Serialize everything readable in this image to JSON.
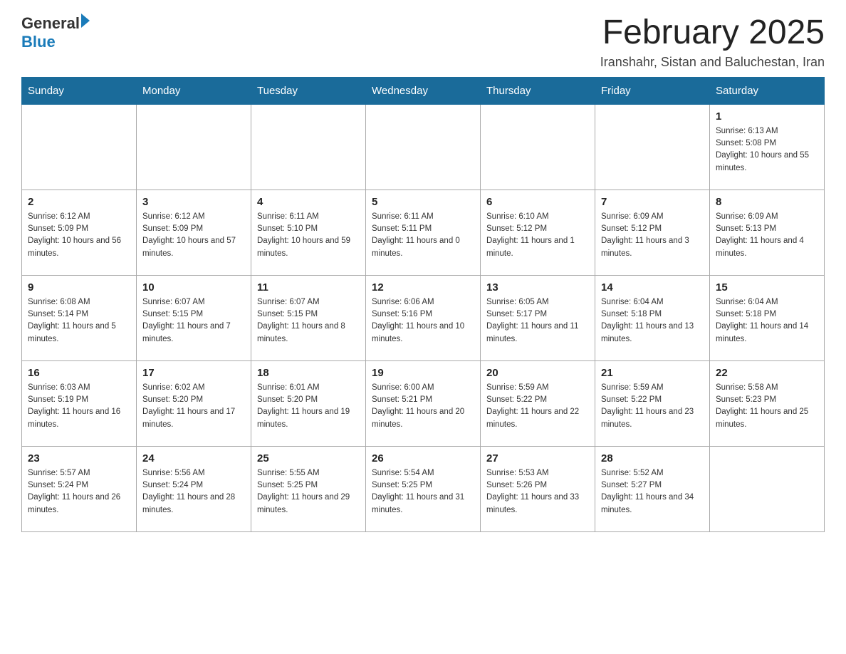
{
  "logo": {
    "general": "General",
    "blue": "Blue"
  },
  "title": "February 2025",
  "location": "Iranshahr, Sistan and Baluchestan, Iran",
  "days_of_week": [
    "Sunday",
    "Monday",
    "Tuesday",
    "Wednesday",
    "Thursday",
    "Friday",
    "Saturday"
  ],
  "weeks": [
    [
      {
        "day": "",
        "info": ""
      },
      {
        "day": "",
        "info": ""
      },
      {
        "day": "",
        "info": ""
      },
      {
        "day": "",
        "info": ""
      },
      {
        "day": "",
        "info": ""
      },
      {
        "day": "",
        "info": ""
      },
      {
        "day": "1",
        "info": "Sunrise: 6:13 AM\nSunset: 5:08 PM\nDaylight: 10 hours and 55 minutes."
      }
    ],
    [
      {
        "day": "2",
        "info": "Sunrise: 6:12 AM\nSunset: 5:09 PM\nDaylight: 10 hours and 56 minutes."
      },
      {
        "day": "3",
        "info": "Sunrise: 6:12 AM\nSunset: 5:09 PM\nDaylight: 10 hours and 57 minutes."
      },
      {
        "day": "4",
        "info": "Sunrise: 6:11 AM\nSunset: 5:10 PM\nDaylight: 10 hours and 59 minutes."
      },
      {
        "day": "5",
        "info": "Sunrise: 6:11 AM\nSunset: 5:11 PM\nDaylight: 11 hours and 0 minutes."
      },
      {
        "day": "6",
        "info": "Sunrise: 6:10 AM\nSunset: 5:12 PM\nDaylight: 11 hours and 1 minute."
      },
      {
        "day": "7",
        "info": "Sunrise: 6:09 AM\nSunset: 5:12 PM\nDaylight: 11 hours and 3 minutes."
      },
      {
        "day": "8",
        "info": "Sunrise: 6:09 AM\nSunset: 5:13 PM\nDaylight: 11 hours and 4 minutes."
      }
    ],
    [
      {
        "day": "9",
        "info": "Sunrise: 6:08 AM\nSunset: 5:14 PM\nDaylight: 11 hours and 5 minutes."
      },
      {
        "day": "10",
        "info": "Sunrise: 6:07 AM\nSunset: 5:15 PM\nDaylight: 11 hours and 7 minutes."
      },
      {
        "day": "11",
        "info": "Sunrise: 6:07 AM\nSunset: 5:15 PM\nDaylight: 11 hours and 8 minutes."
      },
      {
        "day": "12",
        "info": "Sunrise: 6:06 AM\nSunset: 5:16 PM\nDaylight: 11 hours and 10 minutes."
      },
      {
        "day": "13",
        "info": "Sunrise: 6:05 AM\nSunset: 5:17 PM\nDaylight: 11 hours and 11 minutes."
      },
      {
        "day": "14",
        "info": "Sunrise: 6:04 AM\nSunset: 5:18 PM\nDaylight: 11 hours and 13 minutes."
      },
      {
        "day": "15",
        "info": "Sunrise: 6:04 AM\nSunset: 5:18 PM\nDaylight: 11 hours and 14 minutes."
      }
    ],
    [
      {
        "day": "16",
        "info": "Sunrise: 6:03 AM\nSunset: 5:19 PM\nDaylight: 11 hours and 16 minutes."
      },
      {
        "day": "17",
        "info": "Sunrise: 6:02 AM\nSunset: 5:20 PM\nDaylight: 11 hours and 17 minutes."
      },
      {
        "day": "18",
        "info": "Sunrise: 6:01 AM\nSunset: 5:20 PM\nDaylight: 11 hours and 19 minutes."
      },
      {
        "day": "19",
        "info": "Sunrise: 6:00 AM\nSunset: 5:21 PM\nDaylight: 11 hours and 20 minutes."
      },
      {
        "day": "20",
        "info": "Sunrise: 5:59 AM\nSunset: 5:22 PM\nDaylight: 11 hours and 22 minutes."
      },
      {
        "day": "21",
        "info": "Sunrise: 5:59 AM\nSunset: 5:22 PM\nDaylight: 11 hours and 23 minutes."
      },
      {
        "day": "22",
        "info": "Sunrise: 5:58 AM\nSunset: 5:23 PM\nDaylight: 11 hours and 25 minutes."
      }
    ],
    [
      {
        "day": "23",
        "info": "Sunrise: 5:57 AM\nSunset: 5:24 PM\nDaylight: 11 hours and 26 minutes."
      },
      {
        "day": "24",
        "info": "Sunrise: 5:56 AM\nSunset: 5:24 PM\nDaylight: 11 hours and 28 minutes."
      },
      {
        "day": "25",
        "info": "Sunrise: 5:55 AM\nSunset: 5:25 PM\nDaylight: 11 hours and 29 minutes."
      },
      {
        "day": "26",
        "info": "Sunrise: 5:54 AM\nSunset: 5:25 PM\nDaylight: 11 hours and 31 minutes."
      },
      {
        "day": "27",
        "info": "Sunrise: 5:53 AM\nSunset: 5:26 PM\nDaylight: 11 hours and 33 minutes."
      },
      {
        "day": "28",
        "info": "Sunrise: 5:52 AM\nSunset: 5:27 PM\nDaylight: 11 hours and 34 minutes."
      },
      {
        "day": "",
        "info": ""
      }
    ]
  ]
}
